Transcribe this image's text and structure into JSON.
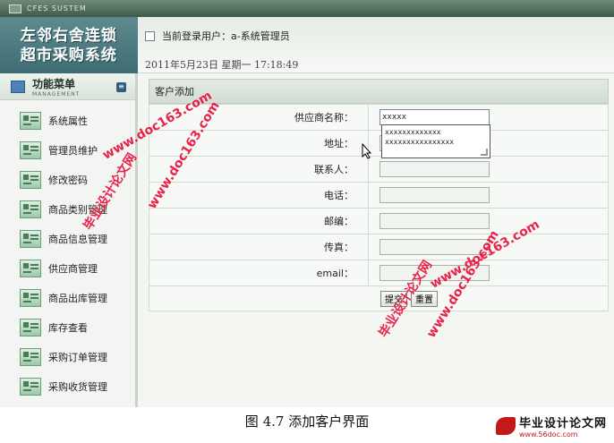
{
  "app": {
    "system_label": "CFES SUSTEM",
    "logo_line1": "左邻右舍连锁",
    "logo_line2": "超市采购系统"
  },
  "header": {
    "login_user": "当前登录用户：a-系统管理员",
    "datetime": "2011年5月23日  星期一  17:18:49"
  },
  "sidebar": {
    "title": "功能菜单",
    "subtitle": "MANAGEMENT",
    "items": [
      {
        "label": "系统属性"
      },
      {
        "label": "管理员维护"
      },
      {
        "label": "修改密码"
      },
      {
        "label": "商品类别管理"
      },
      {
        "label": "商品信息管理"
      },
      {
        "label": "供应商管理"
      },
      {
        "label": "商品出库管理"
      },
      {
        "label": "库存查看"
      },
      {
        "label": "采购订单管理"
      },
      {
        "label": "采购收货管理"
      }
    ]
  },
  "form": {
    "title": "客户添加",
    "fields": [
      {
        "label": "供应商名称：",
        "value": "xxxxx"
      },
      {
        "label": "地址：",
        "value": ""
      },
      {
        "label": "联系人：",
        "value": ""
      },
      {
        "label": "电话：",
        "value": ""
      },
      {
        "label": "邮编：",
        "value": ""
      },
      {
        "label": "传真：",
        "value": ""
      },
      {
        "label": "email：",
        "value": ""
      }
    ],
    "autocomplete": [
      "xxxxxxxxxxxxx",
      "xxxxxxxxxxxxxxxx"
    ],
    "submit_label": "提交",
    "reset_label": "重置"
  },
  "watermarks": {
    "site_url": "www.doc163.com",
    "site_name": "毕业设计论文网"
  },
  "caption": "图 4.7 添加客户界面",
  "corner_logo": {
    "name": "毕业设计论文网",
    "url": "www.56doc.com"
  },
  "colors": {
    "watermark_red": "#e8103a",
    "topbar_green": "#3d5a48",
    "logo_teal": "#3f6b74"
  }
}
